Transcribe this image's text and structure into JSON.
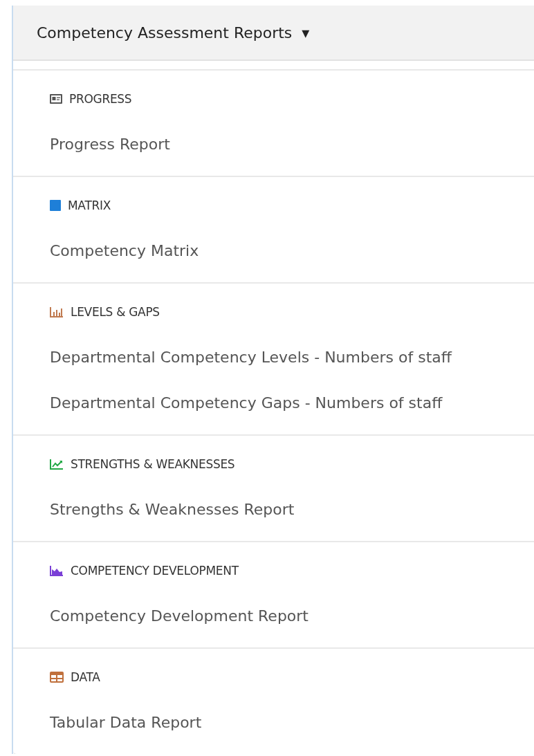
{
  "header": {
    "title": "Competency Assessment Reports",
    "caret": "▾"
  },
  "sections": [
    {
      "heading": "PROGRESS",
      "kind": "id-card",
      "color": "#555555",
      "items": [
        "Progress Report"
      ]
    },
    {
      "heading": "MATRIX",
      "kind": "square",
      "color": "#1e7fd8",
      "items": [
        "Competency Matrix"
      ]
    },
    {
      "heading": "LEVELS & GAPS",
      "kind": "bar-chart",
      "color": "#c07a50",
      "items": [
        "Departmental Competency Levels - Numbers of staff",
        "Departmental Competency Gaps - Numbers of staff"
      ]
    },
    {
      "heading": "STRENGTHS & WEAKNESSES",
      "kind": "line-chart",
      "color": "#22a845",
      "items": [
        "Strengths & Weaknesses Report"
      ]
    },
    {
      "heading": "COMPETENCY DEVELOPMENT",
      "kind": "area-chart",
      "color": "#7a3fd6",
      "items": [
        "Competency Development Report"
      ]
    },
    {
      "heading": "DATA",
      "kind": "table",
      "color": "#c0703c",
      "items": [
        "Tabular Data Report"
      ]
    }
  ]
}
